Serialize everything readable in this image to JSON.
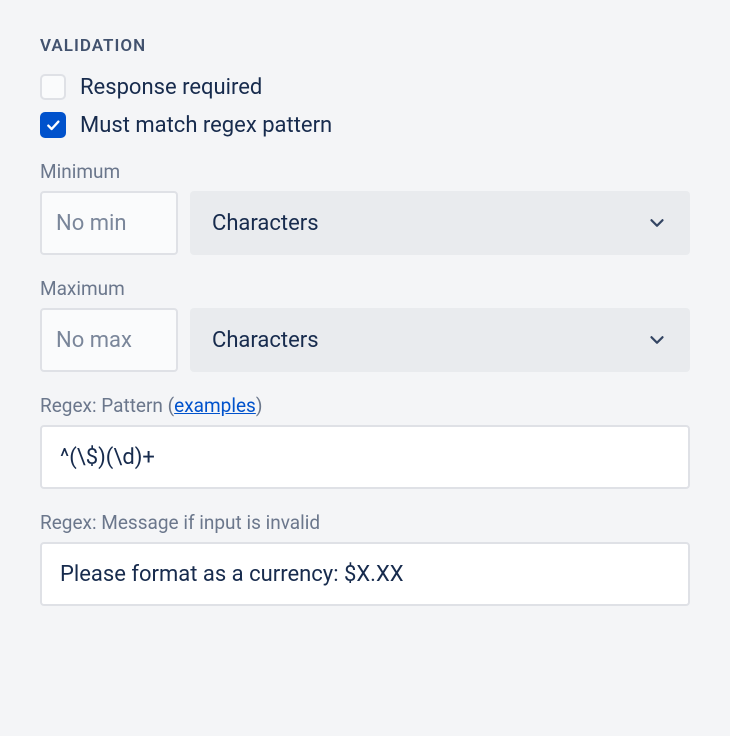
{
  "section": {
    "title": "VALIDATION"
  },
  "checkboxes": {
    "response_required": {
      "label": "Response required",
      "checked": false
    },
    "match_regex": {
      "label": "Must match regex pattern",
      "checked": true
    }
  },
  "minimum": {
    "label": "Minimum",
    "placeholder": "No min",
    "value": "",
    "unit_selected": "Characters"
  },
  "maximum": {
    "label": "Maximum",
    "placeholder": "No max",
    "value": "",
    "unit_selected": "Characters"
  },
  "regex_pattern": {
    "label_prefix": "Regex: Pattern (",
    "label_link": "examples",
    "label_suffix": ")",
    "value": "^(\\$)(\\d)+"
  },
  "regex_message": {
    "label": "Regex: Message if input is invalid",
    "value": "Please format as a currency: $X.XX"
  }
}
